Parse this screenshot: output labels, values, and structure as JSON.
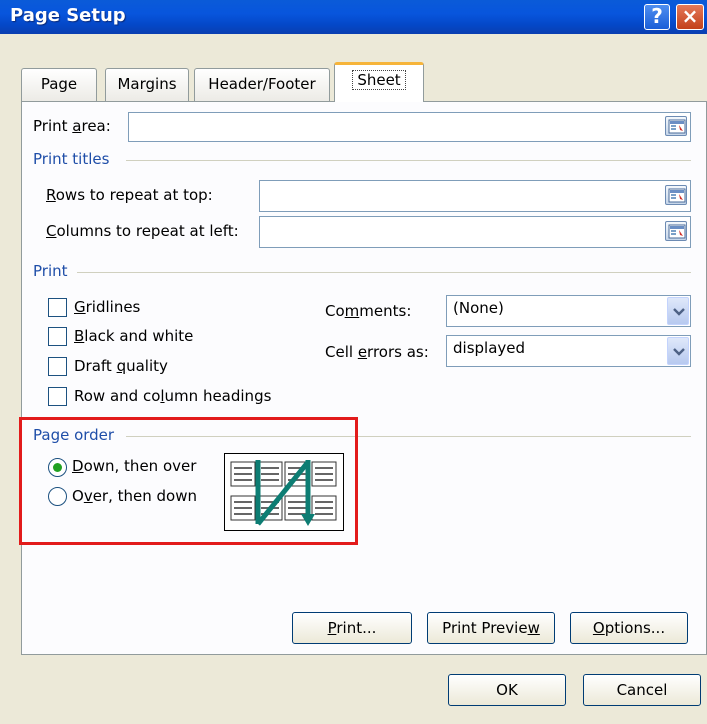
{
  "window": {
    "title": "Page Setup",
    "help_icon": "?",
    "close_icon": "×"
  },
  "tabs": [
    {
      "label": "Page"
    },
    {
      "label": "Margins"
    },
    {
      "label": "Header/Footer"
    },
    {
      "label": "Sheet",
      "active": true
    }
  ],
  "print_area": {
    "label_pre": "Print ",
    "label_u": "a",
    "label_post": "rea:",
    "value": ""
  },
  "print_titles": {
    "heading": "Print titles",
    "rows_label_u": "R",
    "rows_label_post": "ows to repeat at top:",
    "rows_value": "",
    "cols_label_u": "C",
    "cols_label_post": "olumns to repeat at left:",
    "cols_value": ""
  },
  "print": {
    "heading": "Print",
    "checkboxes": [
      {
        "pre": "",
        "u": "G",
        "post": "ridlines",
        "checked": false
      },
      {
        "pre": "",
        "u": "B",
        "post": "lack and white",
        "checked": false
      },
      {
        "pre": "Draft ",
        "u": "q",
        "post": "uality",
        "checked": false
      },
      {
        "pre": "Row and co",
        "u": "l",
        "post": "umn headings",
        "checked": false
      }
    ],
    "comments": {
      "pre": "Co",
      "u": "m",
      "post": "ments:",
      "value": "(None)"
    },
    "cell_errors": {
      "pre": "Cell ",
      "u": "e",
      "post": "rrors as:",
      "value": "displayed"
    }
  },
  "page_order": {
    "heading": "Page order",
    "options": [
      {
        "pre": "",
        "u": "D",
        "post": "own, then over",
        "selected": true
      },
      {
        "pre": "O",
        "u": "v",
        "post": "er, then down",
        "selected": false
      }
    ]
  },
  "buttons": {
    "print": {
      "u": "P",
      "post": "rint..."
    },
    "print_preview": {
      "pre": "Print Previe",
      "u": "w"
    },
    "options": {
      "u": "O",
      "post": "ptions..."
    },
    "ok": "OK",
    "cancel": "Cancel"
  },
  "colors": {
    "title_bar": "#0a5bd8",
    "dialog_bg": "#ece9d8",
    "highlight_box": "#e21b1b",
    "group_title": "#1f4ea8"
  },
  "icons": [
    "help-icon",
    "close-icon",
    "collapse-dialog-icon",
    "dropdown-arrow-icon",
    "page-order-diagram"
  ]
}
